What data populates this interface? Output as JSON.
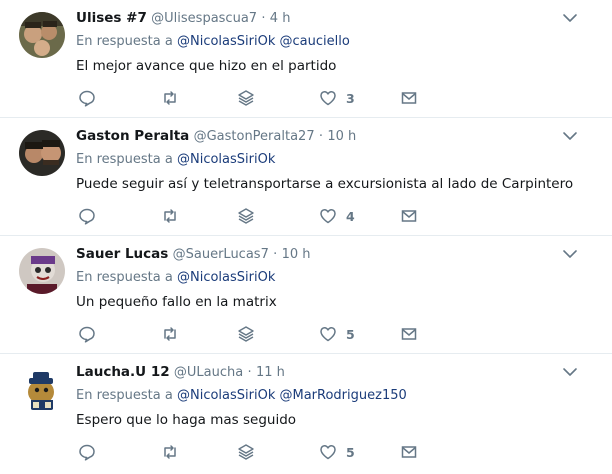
{
  "tweets": [
    {
      "fullname": "Ulises #7",
      "username": "@Ulisespascua7",
      "dot": "·",
      "time": "4 h",
      "reply_prefix": "En respuesta a",
      "mentions": [
        "@NicolasSiriOk",
        "@cauciello"
      ],
      "text": "El mejor avance que hizo en el partido",
      "like_count": "3"
    },
    {
      "fullname": "Gaston Peralta",
      "username": "@GastonPeralta27",
      "dot": "·",
      "time": "10 h",
      "reply_prefix": "En respuesta a",
      "mentions": [
        "@NicolasSiriOk"
      ],
      "text": "Puede seguir así y teletransportarse a excursionista al lado de Carpintero",
      "like_count": "4"
    },
    {
      "fullname": "Sauer Lucas",
      "username": "@SauerLucas7",
      "dot": "·",
      "time": "10 h",
      "reply_prefix": "En respuesta a",
      "mentions": [
        "@NicolasSiriOk"
      ],
      "text": "Un pequeño fallo en la matrix",
      "like_count": "5"
    },
    {
      "fullname": "Laucha.U 12",
      "username": "@ULaucha",
      "dot": "·",
      "time": "11 h",
      "reply_prefix": "En respuesta a",
      "mentions": [
        "@NicolasSiriOk",
        "@MarRodriguez150"
      ],
      "text": "Espero que lo haga mas seguido",
      "like_count": "5"
    }
  ],
  "icons": {
    "reply": "reply-icon",
    "retweet": "retweet-icon",
    "stack": "stack-icon",
    "like": "heart-icon",
    "dm": "envelope-icon",
    "caret": "chevron-down-icon"
  },
  "colors": {
    "mention": "#1b3c7a",
    "secondary_text": "#657786",
    "icon": "#657786",
    "divider": "#e6ecf0"
  }
}
